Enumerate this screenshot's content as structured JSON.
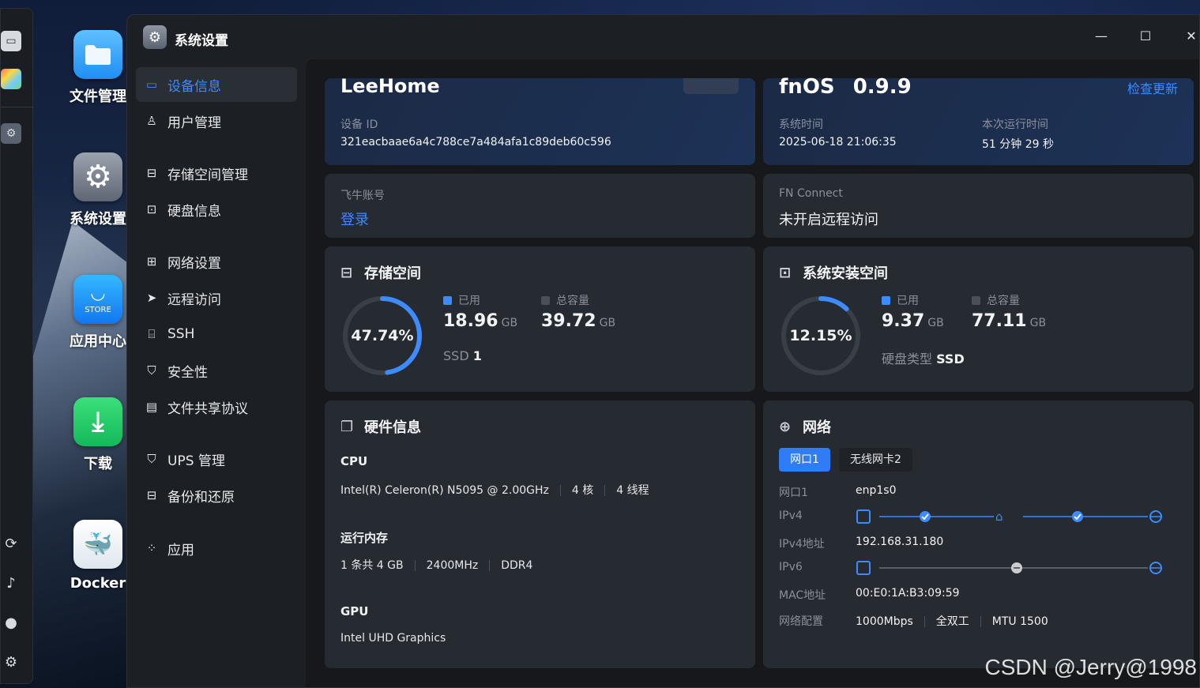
{
  "desktop": {
    "icons": [
      {
        "label": "文件管理"
      },
      {
        "label": "系统设置"
      },
      {
        "label": "应用中心",
        "badge": "STORE"
      },
      {
        "label": "下载"
      },
      {
        "label": "Docker"
      }
    ]
  },
  "window": {
    "title": "系统设置",
    "controls": {
      "minimize": "—",
      "maximize": "☐",
      "close": "✕"
    }
  },
  "sidebar": {
    "items": [
      {
        "label": "设备信息",
        "icon": "device-icon",
        "active": true
      },
      {
        "label": "用户管理",
        "icon": "user-icon"
      },
      {
        "label": "存储空间管理",
        "icon": "storage-icon"
      },
      {
        "label": "硬盘信息",
        "icon": "disk-icon"
      },
      {
        "label": "网络设置",
        "icon": "network-icon"
      },
      {
        "label": "远程访问",
        "icon": "send-icon"
      },
      {
        "label": "SSH",
        "icon": "code-icon"
      },
      {
        "label": "安全性",
        "icon": "shield-icon"
      },
      {
        "label": "文件共享协议",
        "icon": "file-icon"
      },
      {
        "label": "UPS 管理",
        "icon": "ups-icon"
      },
      {
        "label": "备份和还原",
        "icon": "backup-icon"
      },
      {
        "label": "应用",
        "icon": "apps-icon"
      }
    ]
  },
  "device": {
    "name": "LeeHome",
    "id_label": "设备 ID",
    "id_value": "321eacbaae6a4c788ce7a484afa1c89deb60c596"
  },
  "os": {
    "name": "fnOS",
    "version": "0.9.9",
    "check_update": "检查更新",
    "time_label": "系统时间",
    "time_value": "2025-06-18 21:06:35",
    "uptime_label": "本次运行时间",
    "uptime_value": "51 分钟 29 秒"
  },
  "account": {
    "label": "飞牛账号",
    "login": "登录"
  },
  "fn_connect": {
    "label": "FN Connect",
    "status": "未开启远程访问"
  },
  "storage": {
    "title": "存储空间",
    "percent_text": "47.74%",
    "used_fraction": 0.4774,
    "used_label": "已用",
    "used_value": "18.96",
    "used_unit": "GB",
    "total_label": "总容量",
    "total_value": "39.72",
    "total_unit": "GB",
    "type_label": "SSD",
    "type_value": "1"
  },
  "system_space": {
    "title": "系统安装空间",
    "percent_text": "12.15%",
    "used_fraction": 0.1215,
    "used_label": "已用",
    "used_value": "9.37",
    "used_unit": "GB",
    "total_label": "总容量",
    "total_value": "77.11",
    "total_unit": "GB",
    "type_label": "硬盘类型",
    "type_value": "SSD"
  },
  "hardware": {
    "title": "硬件信息",
    "cpu_label": "CPU",
    "cpu_model": "Intel(R) Celeron(R) N5095 @ 2.00GHz",
    "cpu_cores": "4 核",
    "cpu_threads": "4 线程",
    "ram_label": "运行内存",
    "ram_count": "1 条共 4 GB",
    "ram_freq": "2400MHz",
    "ram_type": "DDR4",
    "gpu_label": "GPU",
    "gpu_model": "Intel UHD Graphics"
  },
  "network": {
    "title": "网络",
    "tabs": [
      "网口1",
      "无线网卡2"
    ],
    "port_label": "网口1",
    "port_value": "enp1s0",
    "ipv4_label": "IPv4",
    "ipv4_addr_label": "IPv4地址",
    "ipv4_addr_value": "192.168.31.180",
    "ipv6_label": "IPv6",
    "mac_label": "MAC地址",
    "mac_value": "00:E0:1A:B3:09:59",
    "config_label": "网络配置",
    "config_speed": "1000Mbps",
    "config_duplex": "全双工",
    "config_mtu": "MTU 1500"
  },
  "watermark": "CSDN @Jerry@1998",
  "colors": {
    "accent": "#3d8bff",
    "card": "#262a31",
    "ring_track": "#3a3f47"
  }
}
